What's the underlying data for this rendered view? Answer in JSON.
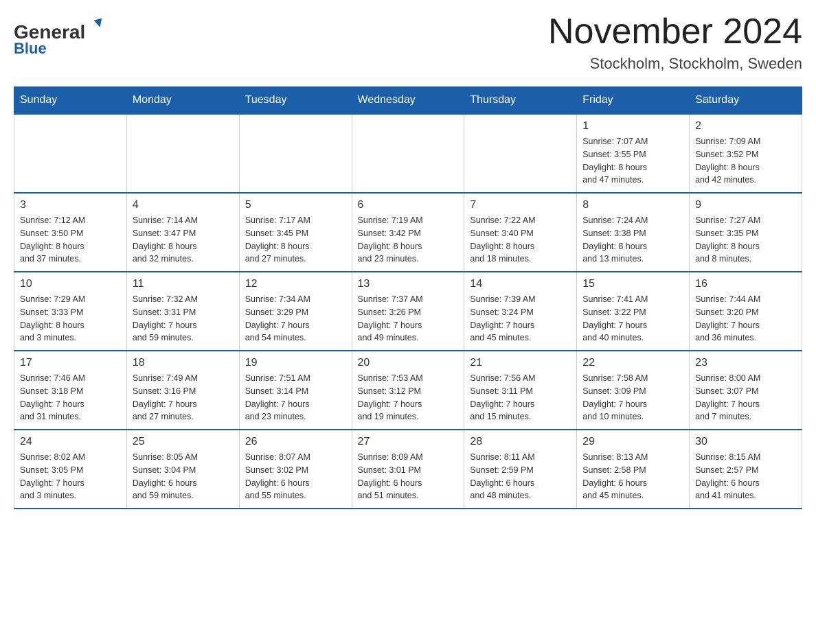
{
  "header": {
    "logo_general": "General",
    "logo_blue": "Blue",
    "month_title": "November 2024",
    "location": "Stockholm, Stockholm, Sweden"
  },
  "days_of_week": [
    "Sunday",
    "Monday",
    "Tuesday",
    "Wednesday",
    "Thursday",
    "Friday",
    "Saturday"
  ],
  "weeks": [
    [
      {
        "day": "",
        "info": ""
      },
      {
        "day": "",
        "info": ""
      },
      {
        "day": "",
        "info": ""
      },
      {
        "day": "",
        "info": ""
      },
      {
        "day": "",
        "info": ""
      },
      {
        "day": "1",
        "info": "Sunrise: 7:07 AM\nSunset: 3:55 PM\nDaylight: 8 hours\nand 47 minutes."
      },
      {
        "day": "2",
        "info": "Sunrise: 7:09 AM\nSunset: 3:52 PM\nDaylight: 8 hours\nand 42 minutes."
      }
    ],
    [
      {
        "day": "3",
        "info": "Sunrise: 7:12 AM\nSunset: 3:50 PM\nDaylight: 8 hours\nand 37 minutes."
      },
      {
        "day": "4",
        "info": "Sunrise: 7:14 AM\nSunset: 3:47 PM\nDaylight: 8 hours\nand 32 minutes."
      },
      {
        "day": "5",
        "info": "Sunrise: 7:17 AM\nSunset: 3:45 PM\nDaylight: 8 hours\nand 27 minutes."
      },
      {
        "day": "6",
        "info": "Sunrise: 7:19 AM\nSunset: 3:42 PM\nDaylight: 8 hours\nand 23 minutes."
      },
      {
        "day": "7",
        "info": "Sunrise: 7:22 AM\nSunset: 3:40 PM\nDaylight: 8 hours\nand 18 minutes."
      },
      {
        "day": "8",
        "info": "Sunrise: 7:24 AM\nSunset: 3:38 PM\nDaylight: 8 hours\nand 13 minutes."
      },
      {
        "day": "9",
        "info": "Sunrise: 7:27 AM\nSunset: 3:35 PM\nDaylight: 8 hours\nand 8 minutes."
      }
    ],
    [
      {
        "day": "10",
        "info": "Sunrise: 7:29 AM\nSunset: 3:33 PM\nDaylight: 8 hours\nand 3 minutes."
      },
      {
        "day": "11",
        "info": "Sunrise: 7:32 AM\nSunset: 3:31 PM\nDaylight: 7 hours\nand 59 minutes."
      },
      {
        "day": "12",
        "info": "Sunrise: 7:34 AM\nSunset: 3:29 PM\nDaylight: 7 hours\nand 54 minutes."
      },
      {
        "day": "13",
        "info": "Sunrise: 7:37 AM\nSunset: 3:26 PM\nDaylight: 7 hours\nand 49 minutes."
      },
      {
        "day": "14",
        "info": "Sunrise: 7:39 AM\nSunset: 3:24 PM\nDaylight: 7 hours\nand 45 minutes."
      },
      {
        "day": "15",
        "info": "Sunrise: 7:41 AM\nSunset: 3:22 PM\nDaylight: 7 hours\nand 40 minutes."
      },
      {
        "day": "16",
        "info": "Sunrise: 7:44 AM\nSunset: 3:20 PM\nDaylight: 7 hours\nand 36 minutes."
      }
    ],
    [
      {
        "day": "17",
        "info": "Sunrise: 7:46 AM\nSunset: 3:18 PM\nDaylight: 7 hours\nand 31 minutes."
      },
      {
        "day": "18",
        "info": "Sunrise: 7:49 AM\nSunset: 3:16 PM\nDaylight: 7 hours\nand 27 minutes."
      },
      {
        "day": "19",
        "info": "Sunrise: 7:51 AM\nSunset: 3:14 PM\nDaylight: 7 hours\nand 23 minutes."
      },
      {
        "day": "20",
        "info": "Sunrise: 7:53 AM\nSunset: 3:12 PM\nDaylight: 7 hours\nand 19 minutes."
      },
      {
        "day": "21",
        "info": "Sunrise: 7:56 AM\nSunset: 3:11 PM\nDaylight: 7 hours\nand 15 minutes."
      },
      {
        "day": "22",
        "info": "Sunrise: 7:58 AM\nSunset: 3:09 PM\nDaylight: 7 hours\nand 10 minutes."
      },
      {
        "day": "23",
        "info": "Sunrise: 8:00 AM\nSunset: 3:07 PM\nDaylight: 7 hours\nand 7 minutes."
      }
    ],
    [
      {
        "day": "24",
        "info": "Sunrise: 8:02 AM\nSunset: 3:05 PM\nDaylight: 7 hours\nand 3 minutes."
      },
      {
        "day": "25",
        "info": "Sunrise: 8:05 AM\nSunset: 3:04 PM\nDaylight: 6 hours\nand 59 minutes."
      },
      {
        "day": "26",
        "info": "Sunrise: 8:07 AM\nSunset: 3:02 PM\nDaylight: 6 hours\nand 55 minutes."
      },
      {
        "day": "27",
        "info": "Sunrise: 8:09 AM\nSunset: 3:01 PM\nDaylight: 6 hours\nand 51 minutes."
      },
      {
        "day": "28",
        "info": "Sunrise: 8:11 AM\nSunset: 2:59 PM\nDaylight: 6 hours\nand 48 minutes."
      },
      {
        "day": "29",
        "info": "Sunrise: 8:13 AM\nSunset: 2:58 PM\nDaylight: 6 hours\nand 45 minutes."
      },
      {
        "day": "30",
        "info": "Sunrise: 8:15 AM\nSunset: 2:57 PM\nDaylight: 6 hours\nand 41 minutes."
      }
    ]
  ]
}
